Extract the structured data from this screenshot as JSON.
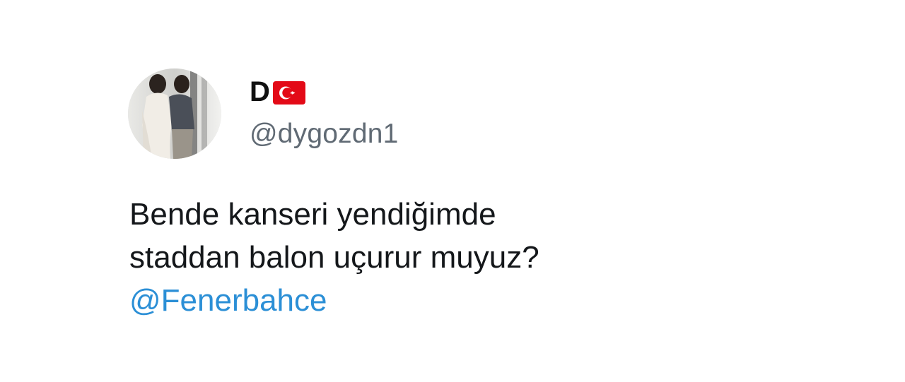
{
  "tweet": {
    "author": {
      "display_name": "D",
      "flag_icon": "turkey-flag-icon",
      "handle": "@dygozdn1"
    },
    "text_lines": [
      "Bende kanseri yendiğimde",
      "staddan balon uçurur muyuz?"
    ],
    "mention": "@Fenerbahce"
  },
  "colors": {
    "mention": "#2b8fd6",
    "handle": "#606a74",
    "text": "#14171a",
    "flag_red": "#e30a17"
  }
}
